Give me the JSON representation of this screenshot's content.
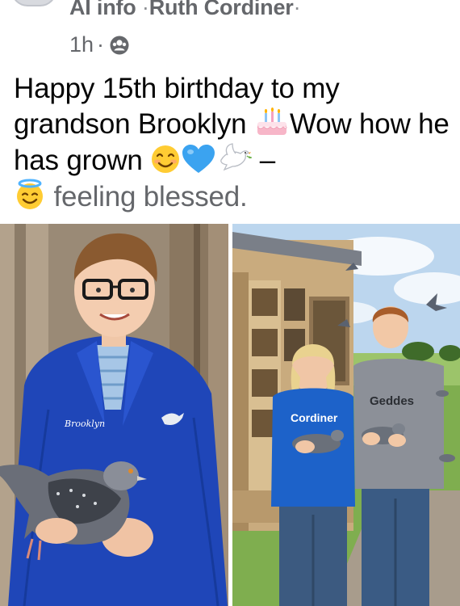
{
  "header": {
    "group_name": "AI info",
    "separator": "·",
    "author": "Ruth Cordiner",
    "time": "1h",
    "privacy_icon": "group-privacy-icon"
  },
  "post": {
    "text_part1": "Happy 15th birthday to my grandson Brooklyn ",
    "text_part2": "Wow how he has grown ",
    "text_part3": " – ",
    "feeling_text": "feeling blessed.",
    "emojis": [
      "birthday-cake",
      "smiling-face",
      "blue-heart",
      "dove",
      "smiling-face-with-halo"
    ]
  },
  "photos": {
    "left": {
      "jacket_name": "Brooklyn"
    },
    "right": {
      "shirt_woman": "Cordiner",
      "shirt_boy": "Geddes"
    }
  },
  "colors": {
    "meta_gray": "#65676b",
    "text": "#050505",
    "jacket_blue": "#1f46b8",
    "sky": "#bcd6ee"
  }
}
